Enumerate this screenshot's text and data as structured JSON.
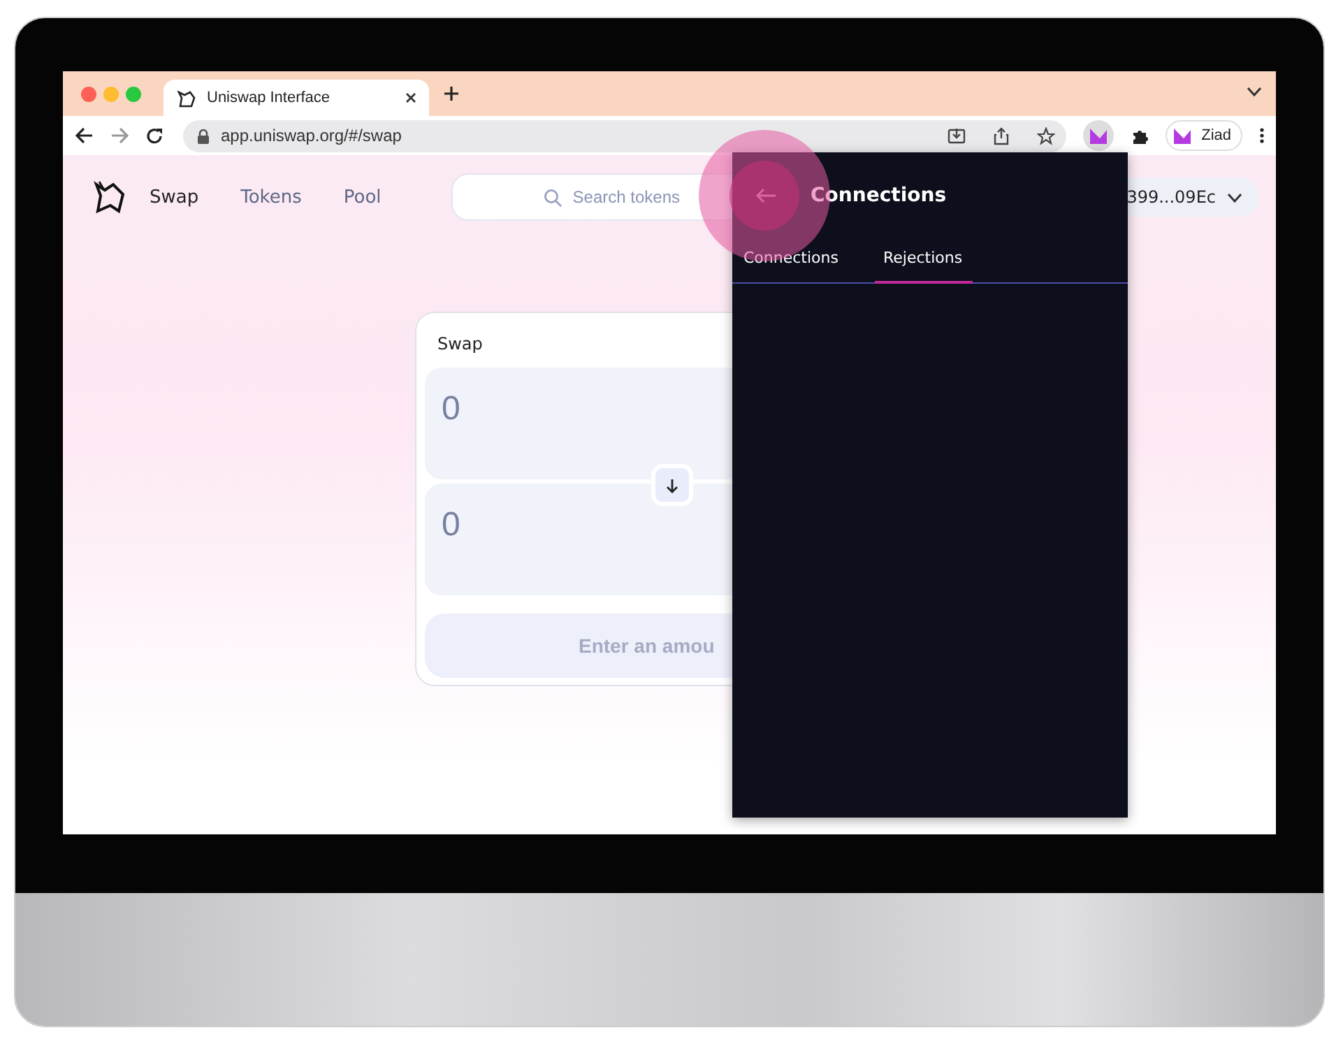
{
  "browser": {
    "tab_title": "Uniswap Interface",
    "url": "app.uniswap.org/#/swap",
    "profile": "Ziad"
  },
  "nav": {
    "items": [
      {
        "label": "Swap",
        "selected": true
      },
      {
        "label": "Tokens",
        "selected": false
      },
      {
        "label": "Pool",
        "selected": false
      }
    ],
    "search": {
      "placeholder": "Search tokens"
    },
    "wallet": "399...09Ec"
  },
  "swap": {
    "title": "Swap",
    "inputs": [
      {
        "value": "0"
      },
      {
        "value": "0"
      }
    ],
    "button": "Enter an amou"
  },
  "popup": {
    "title": "Connections",
    "tabs": [
      {
        "label": "Connections",
        "selected": false
      },
      {
        "label": "Rejections",
        "selected": true
      }
    ]
  }
}
